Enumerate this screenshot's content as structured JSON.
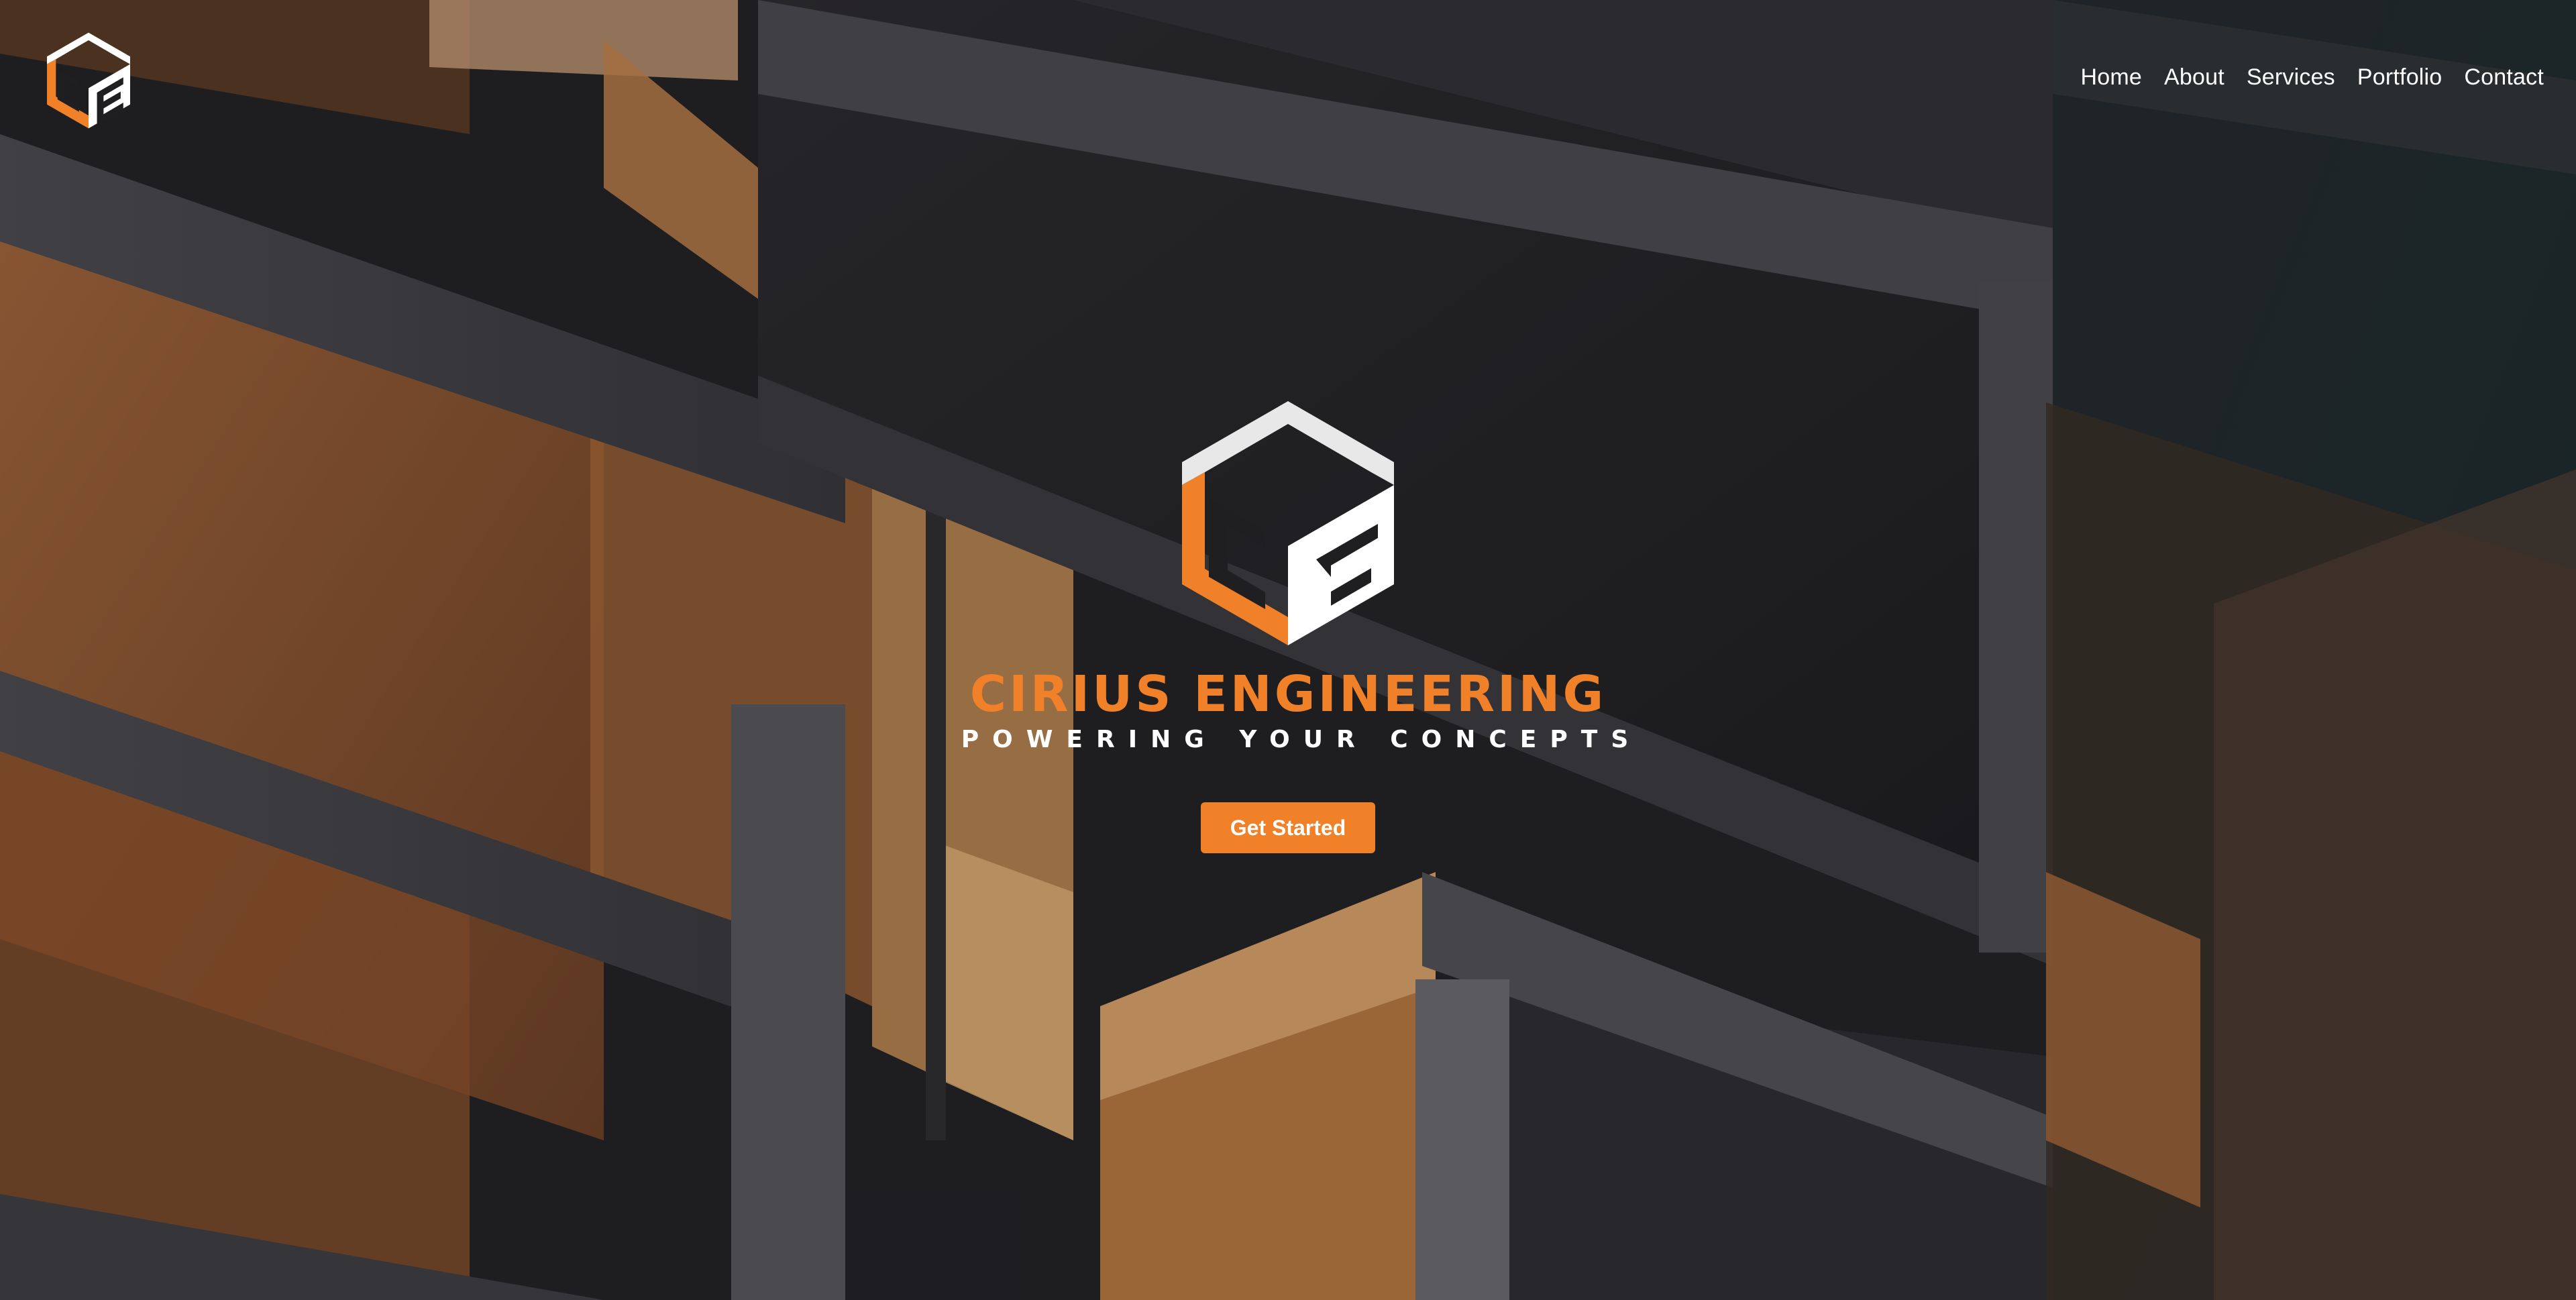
{
  "header": {
    "logo_icon": "ce-cube-logo-icon"
  },
  "nav": {
    "items": [
      {
        "label": "Home"
      },
      {
        "label": "About"
      },
      {
        "label": "Services"
      },
      {
        "label": "Portfolio"
      },
      {
        "label": "Contact"
      }
    ]
  },
  "hero": {
    "logo_icon": "ce-cube-logo-icon",
    "brand_name": "CIRIUS ENGINEERING",
    "tagline": "POWERING YOUR CONCEPTS",
    "cta_label": "Get Started"
  },
  "colors": {
    "accent": "#f08129",
    "text": "#ffffff",
    "background": "#1f1e21"
  }
}
